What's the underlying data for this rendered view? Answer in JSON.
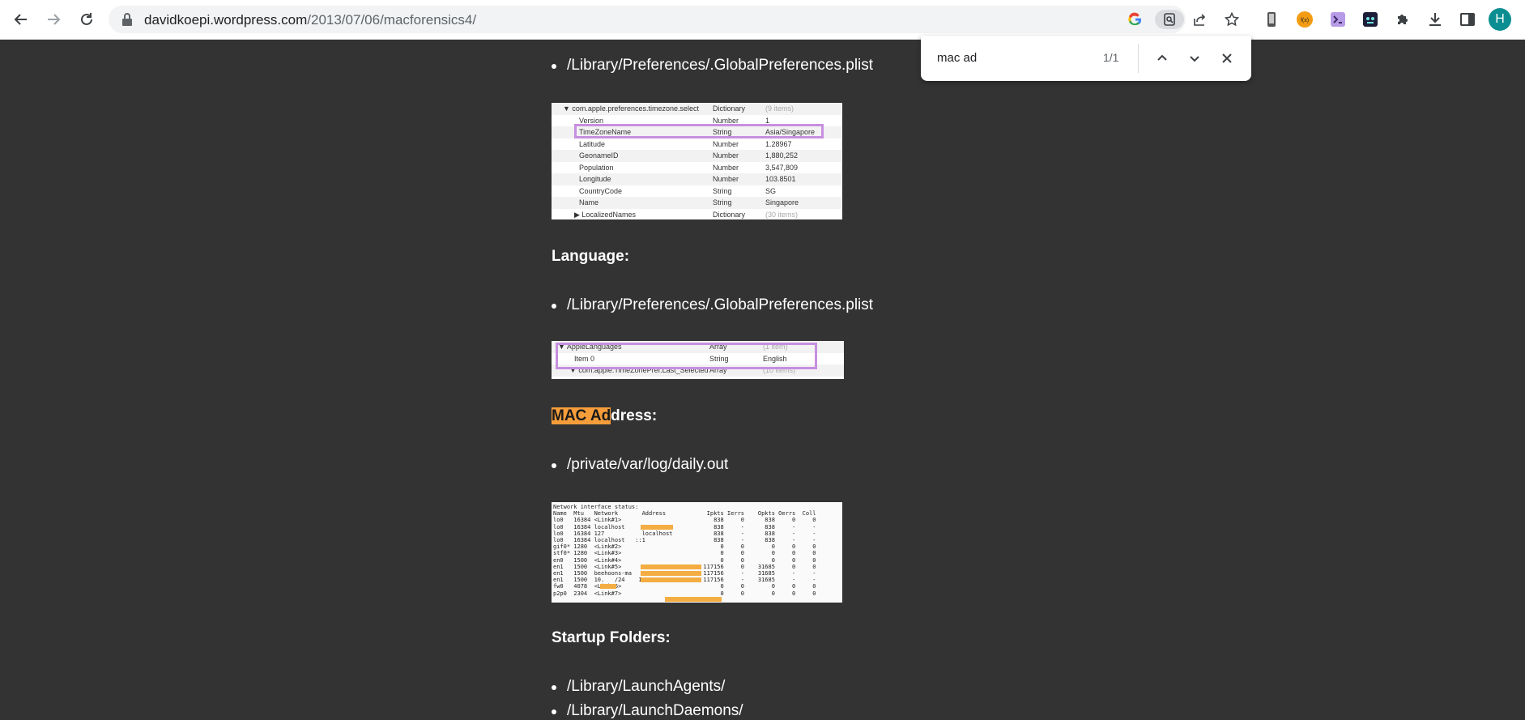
{
  "browser": {
    "url_domain": "davidkoepi.wordpress.com",
    "url_path": "/2013/07/06/macforensics4/",
    "avatar_letter": "H",
    "accent_color": "#0b8e91"
  },
  "find_bar": {
    "query": "mac ad",
    "count": "1/1"
  },
  "content": {
    "bullet_1": "/Library/Preferences/.GlobalPreferences.plist",
    "timezone_table": [
      {
        "key": "▼ com.apple.preferences.timezone.select",
        "type": "Dictionary",
        "value": "(9 items)",
        "grey": true
      },
      {
        "key": "Version",
        "type": "Number",
        "value": "1",
        "grey": false
      },
      {
        "key": "TimeZoneName",
        "type": "String",
        "value": "Asia/Singapore",
        "grey": false
      },
      {
        "key": "Latitude",
        "type": "Number",
        "value": "1.28967",
        "grey": false
      },
      {
        "key": "GeonameID",
        "type": "Number",
        "value": "1,880,252",
        "grey": false
      },
      {
        "key": "Population",
        "type": "Number",
        "value": "3,547,809",
        "grey": false
      },
      {
        "key": "Longitude",
        "type": "Number",
        "value": "103.8501",
        "grey": false
      },
      {
        "key": "CountryCode",
        "type": "String",
        "value": "SG",
        "grey": false
      },
      {
        "key": "Name",
        "type": "String",
        "value": "Singapore",
        "grey": false
      },
      {
        "key": "▶ LocalizedNames",
        "type": "Dictionary",
        "value": "(30 items)",
        "grey": true
      }
    ],
    "heading_language": "Language:",
    "bullet_2": "/Library/Preferences/.GlobalPreferences.plist",
    "language_table": [
      {
        "key": "▼ AppleLanguages",
        "type": "Array",
        "value": "(1 item)",
        "grey": true
      },
      {
        "key": "Item 0",
        "type": "String",
        "value": "English",
        "grey": false
      },
      {
        "key": "▼ com.apple.TimeZonePref.Last_Selected",
        "type": "Array",
        "value": "(10 items)",
        "grey": true
      }
    ],
    "heading_mac_highlight": "MAC Ad",
    "heading_mac_rest": "dress:",
    "bullet_3": "/private/var/log/daily.out",
    "netstat_lines": [
      "Network interface status:",
      "Name  Mtu   Network       Address            Ipkts Ierrs    Opkts Oerrs  Coll",
      "lo0   16384 <Link#1>                           838     0      838     0     0",
      "lo0   16384 localhost                          838     -      838     -     -",
      "lo0   16384 127           localhost            838     -      838     -     -",
      "lo0   16384 localhost   ::1                    838     -      838     -     -",
      "gif0* 1280  <Link#2>                             0     0        0     0     0",
      "stf0* 1280  <Link#3>                             0     0        0     0     0",
      "en0   1500  <Link#4>                             0     0        0     0     0",
      "en1   1500  <Link#5>                        117156     0    31685     0     0",
      "en1   1500  beehoons-ma                     117156     -    31685     -     -",
      "en1   1500  10.   /24    10.     5          117156     -    31685     -     -",
      "fw0   4078  <Link#6>                             0     0        0     0     0",
      "p2p0  2304  <Link#7>                             0     0        0     0     0"
    ],
    "heading_startup": "Startup Folders:",
    "bullet_4": "/Library/LaunchAgents/",
    "bullet_5": "/Library/LaunchDaemons/"
  }
}
